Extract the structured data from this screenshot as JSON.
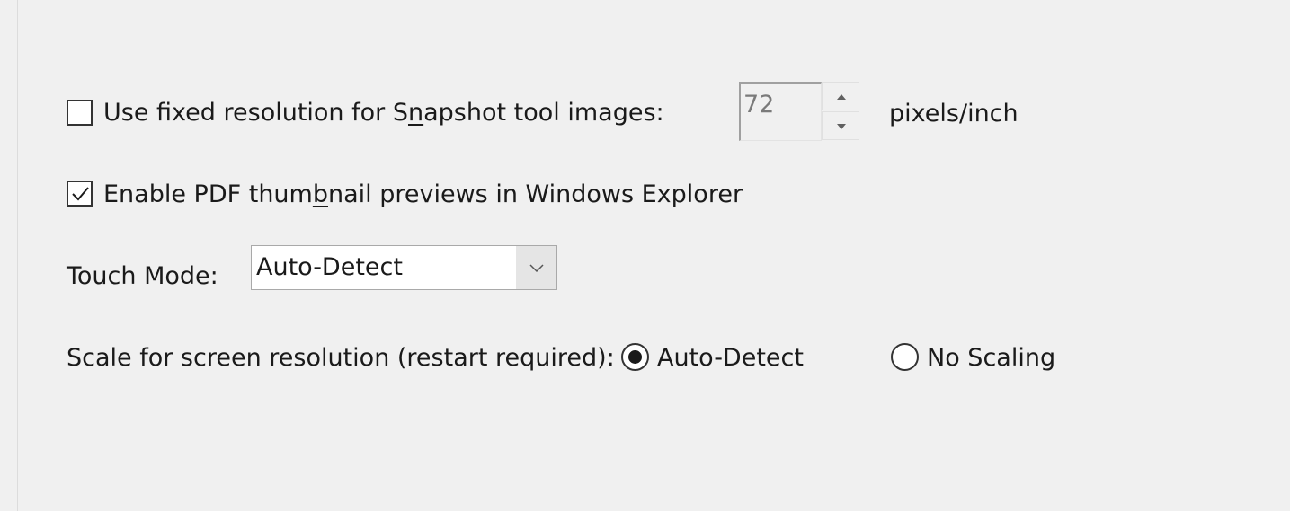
{
  "snapshot": {
    "checkbox_checked": false,
    "label_before": "Use fixed resolution for S",
    "label_accel": "n",
    "label_after": "apshot tool images:",
    "resolution_value": "72",
    "units": "pixels/inch"
  },
  "thumbnail": {
    "checkbox_checked": true,
    "label_before": "Enable PDF thum",
    "label_accel": "b",
    "label_after": "nail previews in Windows Explorer"
  },
  "touch_mode": {
    "label": "Touch Mode:",
    "selected": "Auto-Detect"
  },
  "scaling": {
    "label": "Scale for screen resolution (restart required):",
    "options": [
      {
        "label": "Auto-Detect",
        "selected": true
      },
      {
        "label": "No Scaling",
        "selected": false
      }
    ]
  },
  "icons": {
    "checkmark": "checkmark-icon",
    "spin_up": "chevron-up-icon",
    "spin_down": "chevron-down-icon",
    "dropdown": "chevron-down-icon"
  }
}
